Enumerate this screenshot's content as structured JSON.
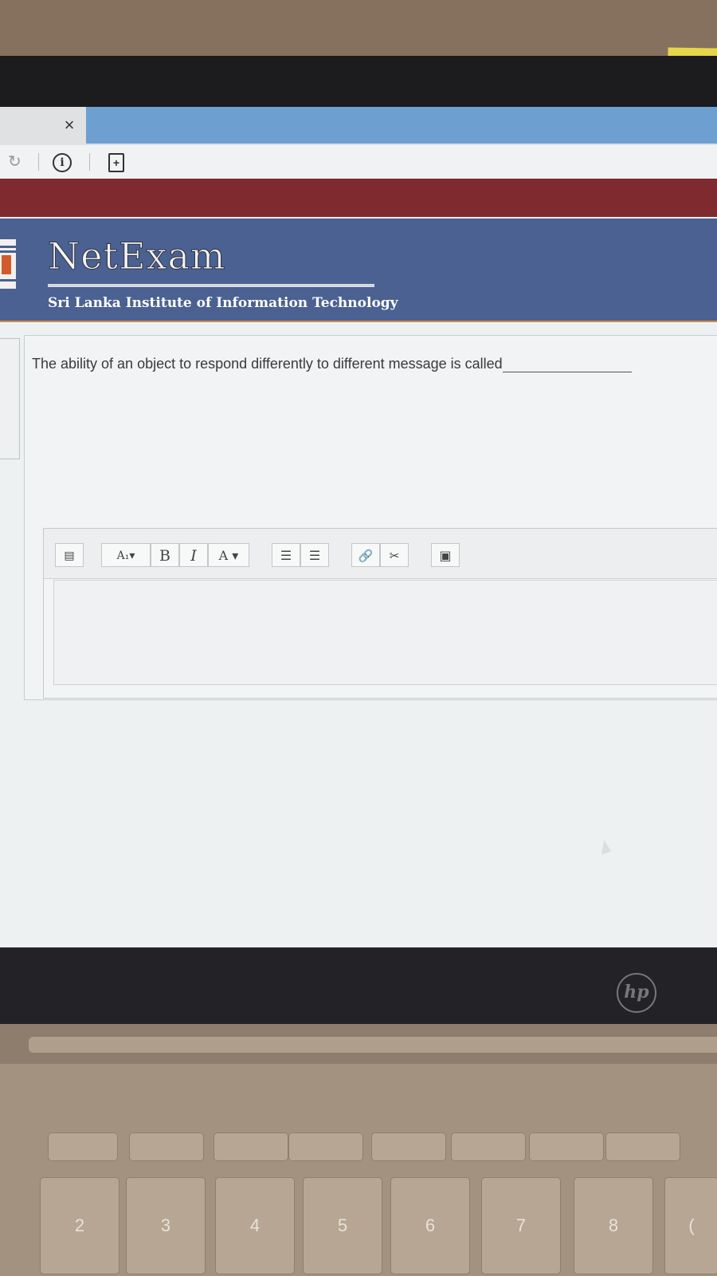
{
  "browser": {
    "tab_close_glyph": "×",
    "reload_glyph": "↻",
    "info_glyph": "i",
    "pdf_glyph": "+"
  },
  "site": {
    "brand": "NetExam",
    "institute": "Sri Lanka Institute of Information Technology"
  },
  "question": {
    "text": "The ability of an object to respond differently to different message is called"
  },
  "editor": {
    "toolbar": {
      "format_label": "A₁▾",
      "bold_label": "B",
      "italic_label": "I",
      "color_label": "A ▾",
      "bullet_list_label": "☰",
      "numbered_list_label": "☰",
      "link_label": "🔗",
      "unlink_label": "✂",
      "image_label": "▣"
    },
    "value": ""
  },
  "device": {
    "logo": "hp",
    "keys": [
      "2",
      "3",
      "4",
      "5",
      "6",
      "7",
      "8",
      "("
    ]
  },
  "colors": {
    "header_bg": "#4a6191",
    "red_band": "#7e2a2e",
    "active_tab": "#6d9fd0"
  }
}
